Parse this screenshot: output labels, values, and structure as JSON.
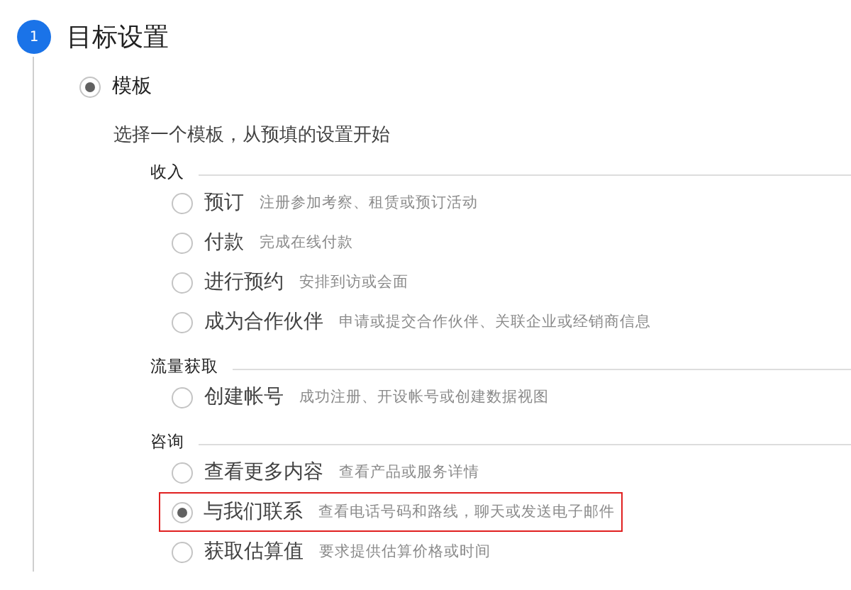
{
  "step": {
    "number": "1",
    "title": "目标设置"
  },
  "template": {
    "label": "模板",
    "selected": true,
    "description": "选择一个模板，从预填的设置开始"
  },
  "groups": [
    {
      "heading": "收入",
      "options": [
        {
          "label": "预订",
          "description": "注册参加考察、租赁或预订活动",
          "selected": false,
          "highlighted": false
        },
        {
          "label": "付款",
          "description": "完成在线付款",
          "selected": false,
          "highlighted": false
        },
        {
          "label": "进行预约",
          "description": "安排到访或会面",
          "selected": false,
          "highlighted": false
        },
        {
          "label": "成为合作伙伴",
          "description": "申请或提交合作伙伴、关联企业或经销商信息",
          "selected": false,
          "highlighted": false
        }
      ]
    },
    {
      "heading": "流量获取",
      "options": [
        {
          "label": "创建帐号",
          "description": "成功注册、开设帐号或创建数据视图",
          "selected": false,
          "highlighted": false
        }
      ]
    },
    {
      "heading": "咨询",
      "options": [
        {
          "label": "查看更多内容",
          "description": "查看产品或服务详情",
          "selected": false,
          "highlighted": false
        },
        {
          "label": "与我们联系",
          "description": "查看电话号码和路线，聊天或发送电子邮件",
          "selected": true,
          "highlighted": true
        },
        {
          "label": "获取估算值",
          "description": "要求提供估算价格或时间",
          "selected": false,
          "highlighted": false
        }
      ]
    }
  ]
}
